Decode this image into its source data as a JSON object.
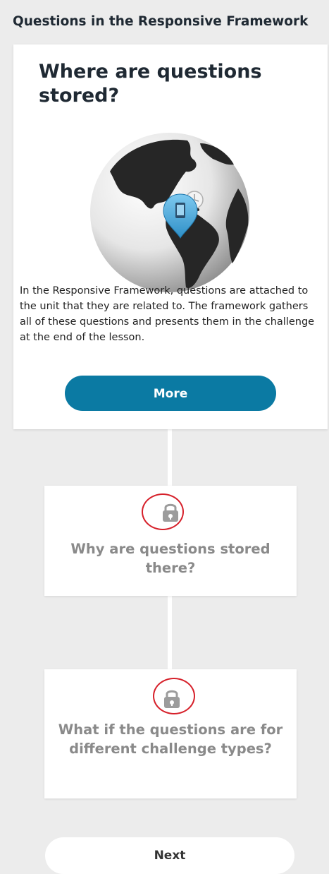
{
  "header": {
    "title": "Questions in the Responsive Framework"
  },
  "main_card": {
    "title": "Where are questions stored?",
    "image_icon": "globe-with-location-pin-icon",
    "body": "In the Responsive Framework, questions are attached to the unit that they are related to. The framework gathers all of these questions and presents them in the challenge at the end of the lesson.",
    "more_label": "More",
    "accent_color": "#0b7aa3"
  },
  "locked_cards": [
    {
      "title": "Why are questions stored there?",
      "icon": "lock-icon",
      "state": "locked"
    },
    {
      "title": "What if the questions are for different challenge types?",
      "icon": "lock-icon",
      "state": "locked"
    }
  ],
  "footer": {
    "next_label": "Next"
  },
  "colors": {
    "background": "#ececec",
    "annotation_circle": "#d6202a",
    "locked_text": "#8a8a8a"
  }
}
